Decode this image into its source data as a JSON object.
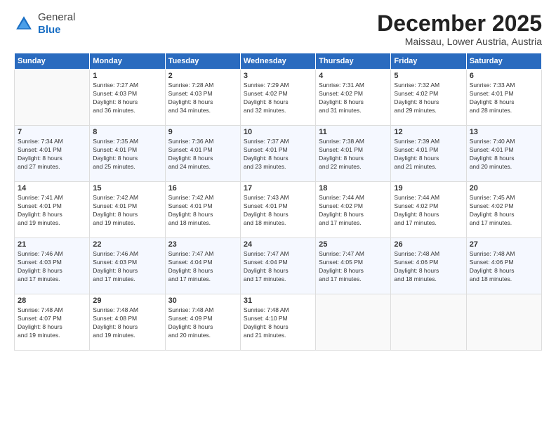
{
  "logo": {
    "line1": "General",
    "line2": "Blue"
  },
  "header": {
    "title": "December 2025",
    "location": "Maissau, Lower Austria, Austria"
  },
  "weekdays": [
    "Sunday",
    "Monday",
    "Tuesday",
    "Wednesday",
    "Thursday",
    "Friday",
    "Saturday"
  ],
  "weeks": [
    [
      {
        "day": "",
        "text": ""
      },
      {
        "day": "1",
        "text": "Sunrise: 7:27 AM\nSunset: 4:03 PM\nDaylight: 8 hours\nand 36 minutes."
      },
      {
        "day": "2",
        "text": "Sunrise: 7:28 AM\nSunset: 4:03 PM\nDaylight: 8 hours\nand 34 minutes."
      },
      {
        "day": "3",
        "text": "Sunrise: 7:29 AM\nSunset: 4:02 PM\nDaylight: 8 hours\nand 32 minutes."
      },
      {
        "day": "4",
        "text": "Sunrise: 7:31 AM\nSunset: 4:02 PM\nDaylight: 8 hours\nand 31 minutes."
      },
      {
        "day": "5",
        "text": "Sunrise: 7:32 AM\nSunset: 4:02 PM\nDaylight: 8 hours\nand 29 minutes."
      },
      {
        "day": "6",
        "text": "Sunrise: 7:33 AM\nSunset: 4:01 PM\nDaylight: 8 hours\nand 28 minutes."
      }
    ],
    [
      {
        "day": "7",
        "text": "Sunrise: 7:34 AM\nSunset: 4:01 PM\nDaylight: 8 hours\nand 27 minutes."
      },
      {
        "day": "8",
        "text": "Sunrise: 7:35 AM\nSunset: 4:01 PM\nDaylight: 8 hours\nand 25 minutes."
      },
      {
        "day": "9",
        "text": "Sunrise: 7:36 AM\nSunset: 4:01 PM\nDaylight: 8 hours\nand 24 minutes."
      },
      {
        "day": "10",
        "text": "Sunrise: 7:37 AM\nSunset: 4:01 PM\nDaylight: 8 hours\nand 23 minutes."
      },
      {
        "day": "11",
        "text": "Sunrise: 7:38 AM\nSunset: 4:01 PM\nDaylight: 8 hours\nand 22 minutes."
      },
      {
        "day": "12",
        "text": "Sunrise: 7:39 AM\nSunset: 4:01 PM\nDaylight: 8 hours\nand 21 minutes."
      },
      {
        "day": "13",
        "text": "Sunrise: 7:40 AM\nSunset: 4:01 PM\nDaylight: 8 hours\nand 20 minutes."
      }
    ],
    [
      {
        "day": "14",
        "text": "Sunrise: 7:41 AM\nSunset: 4:01 PM\nDaylight: 8 hours\nand 19 minutes."
      },
      {
        "day": "15",
        "text": "Sunrise: 7:42 AM\nSunset: 4:01 PM\nDaylight: 8 hours\nand 19 minutes."
      },
      {
        "day": "16",
        "text": "Sunrise: 7:42 AM\nSunset: 4:01 PM\nDaylight: 8 hours\nand 18 minutes."
      },
      {
        "day": "17",
        "text": "Sunrise: 7:43 AM\nSunset: 4:01 PM\nDaylight: 8 hours\nand 18 minutes."
      },
      {
        "day": "18",
        "text": "Sunrise: 7:44 AM\nSunset: 4:02 PM\nDaylight: 8 hours\nand 17 minutes."
      },
      {
        "day": "19",
        "text": "Sunrise: 7:44 AM\nSunset: 4:02 PM\nDaylight: 8 hours\nand 17 minutes."
      },
      {
        "day": "20",
        "text": "Sunrise: 7:45 AM\nSunset: 4:02 PM\nDaylight: 8 hours\nand 17 minutes."
      }
    ],
    [
      {
        "day": "21",
        "text": "Sunrise: 7:46 AM\nSunset: 4:03 PM\nDaylight: 8 hours\nand 17 minutes."
      },
      {
        "day": "22",
        "text": "Sunrise: 7:46 AM\nSunset: 4:03 PM\nDaylight: 8 hours\nand 17 minutes."
      },
      {
        "day": "23",
        "text": "Sunrise: 7:47 AM\nSunset: 4:04 PM\nDaylight: 8 hours\nand 17 minutes."
      },
      {
        "day": "24",
        "text": "Sunrise: 7:47 AM\nSunset: 4:04 PM\nDaylight: 8 hours\nand 17 minutes."
      },
      {
        "day": "25",
        "text": "Sunrise: 7:47 AM\nSunset: 4:05 PM\nDaylight: 8 hours\nand 17 minutes."
      },
      {
        "day": "26",
        "text": "Sunrise: 7:48 AM\nSunset: 4:06 PM\nDaylight: 8 hours\nand 18 minutes."
      },
      {
        "day": "27",
        "text": "Sunrise: 7:48 AM\nSunset: 4:06 PM\nDaylight: 8 hours\nand 18 minutes."
      }
    ],
    [
      {
        "day": "28",
        "text": "Sunrise: 7:48 AM\nSunset: 4:07 PM\nDaylight: 8 hours\nand 19 minutes."
      },
      {
        "day": "29",
        "text": "Sunrise: 7:48 AM\nSunset: 4:08 PM\nDaylight: 8 hours\nand 19 minutes."
      },
      {
        "day": "30",
        "text": "Sunrise: 7:48 AM\nSunset: 4:09 PM\nDaylight: 8 hours\nand 20 minutes."
      },
      {
        "day": "31",
        "text": "Sunrise: 7:48 AM\nSunset: 4:10 PM\nDaylight: 8 hours\nand 21 minutes."
      },
      {
        "day": "",
        "text": ""
      },
      {
        "day": "",
        "text": ""
      },
      {
        "day": "",
        "text": ""
      }
    ]
  ]
}
